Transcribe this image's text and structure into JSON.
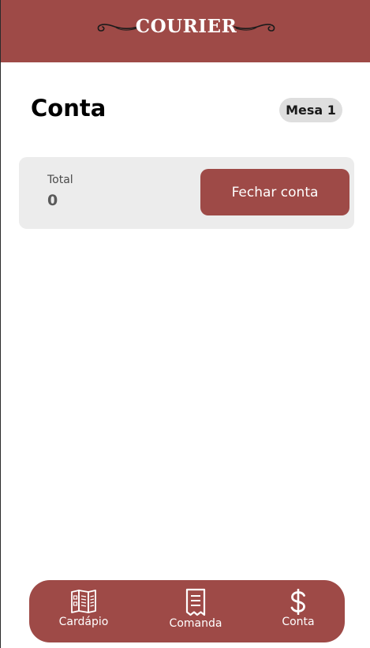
{
  "header": {
    "logo_text": "COURIER",
    "logo_icons": [
      "left-swirl-ornament-icon",
      "right-swirl-ornament-icon"
    ],
    "background_color": "#9e4a47"
  },
  "page": {
    "title": "Conta",
    "table_badge": "Mesa 1"
  },
  "summary": {
    "total_label": "Total",
    "total_value": "0",
    "close_button_label": "Fechar conta"
  },
  "bottom_nav": {
    "items": [
      {
        "label": "Cardápio",
        "icon": "menu-book-icon"
      },
      {
        "label": "Comanda",
        "icon": "receipt-icon"
      },
      {
        "label": "Conta",
        "icon": "dollar-icon"
      }
    ]
  },
  "colors": {
    "accent": "#9e4a47",
    "card_background": "#ececec",
    "badge_background": "#dedede"
  }
}
